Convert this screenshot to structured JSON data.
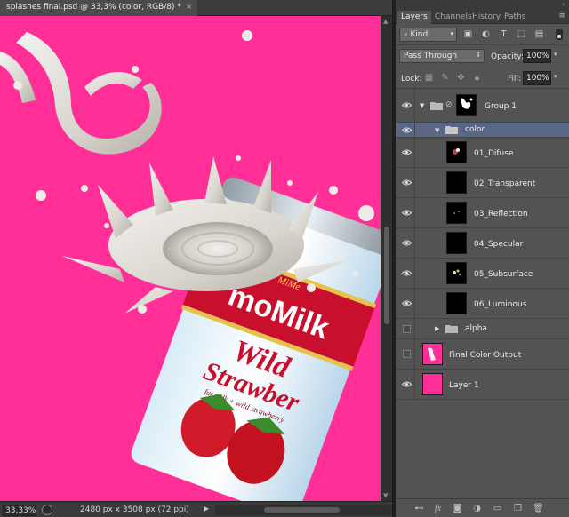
{
  "document": {
    "tab_title": "splashes final.psd @ 33,3% (color, RGB/8) *",
    "close_glyph": "×",
    "canvas_color": "#ff2f97",
    "can_label": {
      "brand_small": "MiMe",
      "brand": "moMilk",
      "flavor_line1": "Wild",
      "flavor_line2": "Strawber",
      "subline": "fat milk + wild strawberry"
    }
  },
  "status_bar": {
    "zoom": "33,33%",
    "doc_size": "2480 px x 3508 px (72 ppi)",
    "arrow": "▶"
  },
  "panel": {
    "tabs": [
      {
        "label": "Layers",
        "active": true
      },
      {
        "label": "Channels",
        "active": false
      },
      {
        "label": "History",
        "active": false
      },
      {
        "label": "Paths",
        "active": false
      }
    ],
    "menu_glyph": "≡",
    "collapse_glyph": "»",
    "filter": {
      "kind_label": "Kind",
      "icons": [
        "search-icon",
        "image-filter-icon",
        "adjustment-filter-icon",
        "type-filter-icon",
        "shape-filter-icon",
        "smart-object-filter-icon"
      ]
    },
    "blend_mode": "Pass Through",
    "opacity_label": "Opacity:",
    "opacity_value": "100%",
    "lock_label": "Lock:",
    "fill_label": "Fill:",
    "fill_value": "100%",
    "layers": [
      {
        "name": "Group 1",
        "kind": "group",
        "visible": true,
        "expanded": true,
        "indent": 0,
        "selected": false
      },
      {
        "name": "color",
        "kind": "group",
        "visible": true,
        "expanded": true,
        "indent": 1,
        "selected": true
      },
      {
        "name": "01_Difuse",
        "kind": "layer",
        "visible": true,
        "indent": 2
      },
      {
        "name": "02_Transparent",
        "kind": "layer",
        "visible": true,
        "indent": 2
      },
      {
        "name": "03_Reflection",
        "kind": "layer",
        "visible": true,
        "indent": 2
      },
      {
        "name": "04_Specular",
        "kind": "layer",
        "visible": true,
        "indent": 2
      },
      {
        "name": "05_Subsurface",
        "kind": "layer",
        "visible": true,
        "indent": 2
      },
      {
        "name": "06_Luminous",
        "kind": "layer",
        "visible": true,
        "indent": 2
      },
      {
        "name": "alpha",
        "kind": "group",
        "visible": false,
        "expanded": false,
        "indent": 1
      },
      {
        "name": "Final Color Output",
        "kind": "layer",
        "visible": false,
        "indent": 0
      },
      {
        "name": "Layer 1",
        "kind": "layer",
        "visible": true,
        "indent": 0
      }
    ],
    "footer_icons": [
      "link-layers-icon",
      "fx-icon",
      "add-mask-icon",
      "adjustment-layer-icon",
      "new-group-icon",
      "new-layer-icon",
      "delete-icon"
    ]
  }
}
